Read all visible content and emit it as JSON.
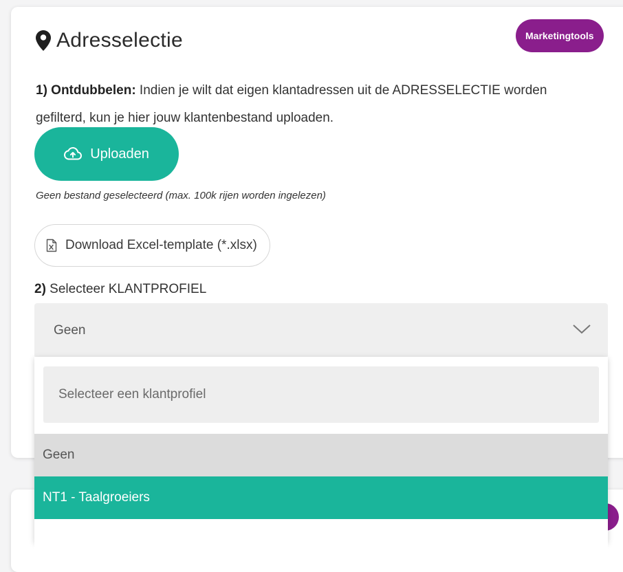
{
  "card": {
    "title": "Adresselectie",
    "badge": "Marketingtools",
    "step1": {
      "label": "1) Ontdubbelen:",
      "text": " Indien je wilt dat eigen klantadressen uit de ADRESSELECTIE worden gefilterd, kun je hier jouw klantenbestand uploaden."
    },
    "upload_label": "Uploaden",
    "file_hint": "Geen bestand geselecteerd (max. 100k rijen worden ingelezen)",
    "download_label": "Download Excel-template (*.xlsx)",
    "step2": {
      "label": "2)",
      "text": " Selecteer KLANTPROFIEL"
    },
    "select_value": "Geen"
  },
  "dropdown": {
    "search_placeholder": "Selecteer een klantprofiel",
    "options": [
      "Geen",
      "NT1 - Taalgroeiers"
    ]
  },
  "colors": {
    "accent": "#1ab59b",
    "badge": "#8a1e8c"
  },
  "icons": {
    "title": "map-pin-icon",
    "upload": "cloud-upload-icon",
    "download": "excel-file-icon",
    "select": "chevron-down-icon"
  }
}
